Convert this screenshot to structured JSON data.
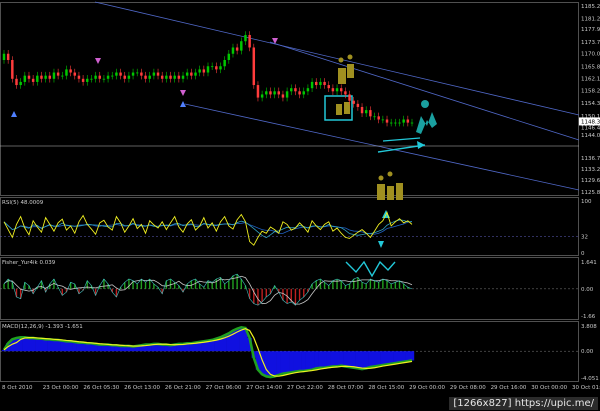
{
  "watermark": "[1266x827] https://upic.me/",
  "colors": {
    "background": "#000000",
    "bull": "#00c800",
    "bear": "#ff3c3c",
    "channel": "#5068c8",
    "hline": "#c0c0c0",
    "cyan": "#22c8d8",
    "olive": "#a09020",
    "yellow": "#f0f020",
    "macd_hist": "#1010e0",
    "fisher_pos": "#20a020",
    "fisher_neg": "#c02020",
    "teal": "#1aa0a0",
    "magenta": "#d060d0"
  },
  "icons": [
    "up-arrow-icon",
    "down-arrow-icon",
    "wave-pattern-icon"
  ],
  "chart_data": [
    {
      "type": "candlestick",
      "yaxis": {
        "ticks": [
          "1185.25",
          "1181.20",
          "1177.95",
          "1173.71",
          "1170.00",
          "1165.87",
          "1162.10",
          "1158.26",
          "1154.30",
          "1150.14",
          "1146.45",
          "1144.04",
          "1136.75",
          "1133.25",
          "1129.63",
          "1125.84"
        ]
      },
      "current_price": "1148.38",
      "xaxis": {
        "ticks": [
          "8 Oct 2010",
          "23 Oct 00:00",
          "26 Oct 05:30",
          "26 Oct 13:00",
          "26 Oct 21:00",
          "27 Oct 06:00",
          "27 Oct 14:00",
          "27 Oct 22:00",
          "28 Oct 07:00",
          "28 Oct 15:00",
          "29 Oct 00:00",
          "29 Oct 08:00",
          "29 Oct 16:00",
          "30 Oct 00:00",
          "30 Oct 01:00"
        ]
      },
      "close": [
        1170,
        1168,
        1162,
        1160,
        1161,
        1163,
        1162,
        1161,
        1163,
        1162,
        1163,
        1162,
        1164,
        1163,
        1163,
        1165,
        1164,
        1163,
        1162,
        1161,
        1162,
        1162,
        1163,
        1162,
        1162,
        1163,
        1163,
        1164,
        1163,
        1162,
        1163,
        1164,
        1164,
        1163,
        1162,
        1163,
        1164,
        1163,
        1162,
        1163,
        1162,
        1163,
        1162,
        1163,
        1164,
        1163,
        1164,
        1165,
        1164,
        1166,
        1166,
        1165,
        1166,
        1168,
        1170,
        1172,
        1171,
        1174,
        1176,
        1172,
        1160,
        1156,
        1157,
        1158,
        1157,
        1158,
        1157,
        1156,
        1158,
        1159,
        1158,
        1157,
        1158,
        1159,
        1161,
        1160,
        1161,
        1160,
        1159,
        1158,
        1159,
        1158,
        1157,
        1155,
        1154,
        1153,
        1151,
        1152,
        1150,
        1150,
        1149,
        1149,
        1148,
        1148,
        1148,
        1148,
        1149,
        1148,
        1148
      ]
    },
    {
      "type": "line",
      "title": "RSI(5) 48.0009",
      "yaxis": {
        "ticks": [
          "100",
          "32",
          "0"
        ]
      },
      "series": [
        {
          "values": [
            60,
            45,
            30,
            55,
            70,
            48,
            35,
            62,
            50,
            40,
            68,
            55,
            42,
            58,
            65,
            44,
            52,
            38,
            60,
            72,
            55,
            46,
            36,
            58,
            63,
            50,
            44,
            70,
            58,
            40,
            52,
            66,
            47,
            55,
            38,
            62,
            54,
            48,
            60,
            45,
            58,
            70,
            50,
            40,
            56,
            64,
            44,
            52,
            68,
            48,
            58,
            42,
            60,
            70,
            52,
            46,
            64,
            74,
            60,
            22,
            15,
            30,
            42,
            38,
            50,
            45,
            38,
            60,
            55,
            44,
            48,
            58,
            50,
            40,
            62,
            52,
            45,
            55,
            60,
            42,
            48,
            38,
            30,
            28,
            34,
            40,
            45,
            38,
            30,
            42,
            55,
            62,
            78,
            52,
            60,
            66,
            58,
            62,
            55
          ]
        }
      ]
    },
    {
      "type": "area",
      "title": "Fisher_Yur4ik 0.039",
      "yaxis": {
        "ticks": [
          "1.641",
          "0.00",
          "-1.66"
        ]
      },
      "series": [
        {
          "values": [
            0.3,
            0.6,
            0.4,
            -0.5,
            -0.6,
            0.4,
            0.2,
            -0.3,
            0.1,
            0.5,
            -0.2,
            0.3,
            0.6,
            0.1,
            -0.4,
            -0.2,
            0.4,
            0.3,
            -0.3,
            -0.1,
            0.5,
            0.2,
            -0.4,
            0.2,
            0.6,
            0.3,
            -0.2,
            -0.5,
            0.1,
            0.4,
            0.6,
            0.5,
            0.3,
            0.6,
            0.4,
            0.6,
            0.3,
            0.1,
            -0.3,
            0.5,
            0.6,
            0.4,
            0.2,
            -0.2,
            0.3,
            0.5,
            0.6,
            0.3,
            0.1,
            0.5,
            0.4,
            0.6,
            0.7,
            0.3,
            0.5,
            0.8,
            0.9,
            0.6,
            0.2,
            -0.6,
            -0.9,
            -1.0,
            -0.8,
            -0.5,
            -0.3,
            0.2,
            -0.2,
            -0.7,
            -0.9,
            -0.8,
            -1.0,
            -0.7,
            -0.5,
            -0.2,
            0.3,
            0.5,
            0.6,
            0.4,
            0.2,
            0.5,
            0.6,
            0.5,
            0.2,
            0.3,
            0.6,
            0.7,
            0.4,
            0.3,
            0.6,
            0.5,
            0.4,
            0.6,
            0.5,
            0.3,
            0.4,
            0.5,
            0.3,
            0.1,
            0.0
          ]
        }
      ]
    },
    {
      "type": "bar",
      "title": "MACD(12,26,9) -1.393 -1.651",
      "yaxis": {
        "ticks": [
          "3.808",
          "0.00",
          "-4.051"
        ]
      },
      "series": [
        {
          "values": [
            0.2,
            1.2,
            1.8,
            2.0,
            2.1,
            2.1,
            2.0,
            2.0,
            1.9,
            1.9,
            1.8,
            1.8,
            1.7,
            1.7,
            1.6,
            1.5,
            1.5,
            1.4,
            1.3,
            1.3,
            1.2,
            1.2,
            1.1,
            1.0,
            1.0,
            1.0,
            0.9,
            0.9,
            0.8,
            0.8,
            0.8,
            0.7,
            0.8,
            0.9,
            1.0,
            1.0,
            1.1,
            1.1,
            1.0,
            1.0,
            0.9,
            1.0,
            1.1,
            1.1,
            1.2,
            1.2,
            1.3,
            1.4,
            1.5,
            1.6,
            1.7,
            1.9,
            2.1,
            2.4,
            2.7,
            3.1,
            3.4,
            3.6,
            3.5,
            2.0,
            -1.0,
            -2.8,
            -3.5,
            -3.8,
            -3.9,
            -3.8,
            -3.6,
            -3.4,
            -3.3,
            -3.2,
            -3.1,
            -3.0,
            -3.0,
            -2.9,
            -2.8,
            -2.6,
            -2.5,
            -2.5,
            -2.4,
            -2.3,
            -2.3,
            -2.2,
            -2.3,
            -2.4,
            -2.5,
            -2.6,
            -2.7,
            -2.6,
            -2.4,
            -2.3,
            -2.2,
            -2.1,
            -2.0,
            -1.9,
            -1.8,
            -1.7,
            -1.6,
            -1.5,
            -1.4
          ]
        }
      ]
    }
  ]
}
